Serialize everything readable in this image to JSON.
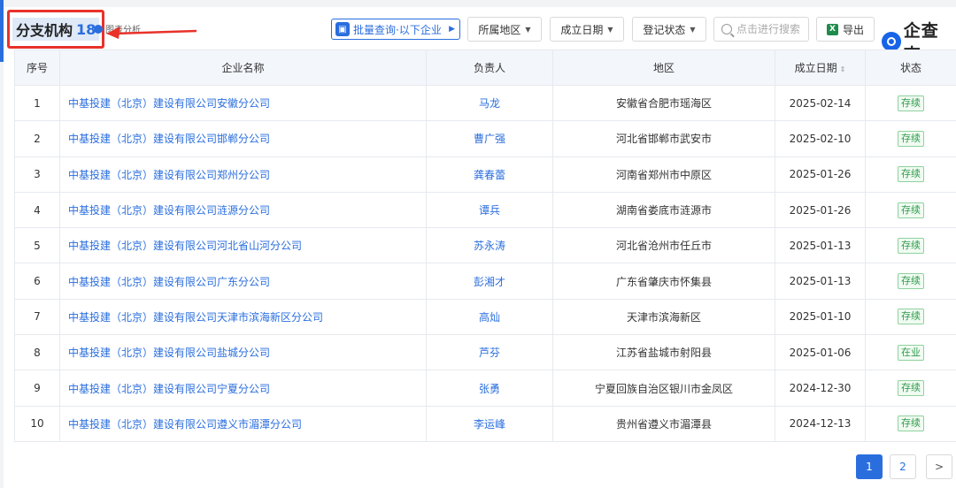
{
  "header": {
    "title": "分支机构",
    "count": "18",
    "chart_link": "图表分析",
    "batch_query": "批量查询·以下企业",
    "filters": [
      "所属地区",
      "成立日期",
      "登记状态"
    ],
    "search_placeholder": "点击进行搜索",
    "export_label": "导出",
    "logo_text": "企查查"
  },
  "table": {
    "columns": [
      "序号",
      "企业名称",
      "负责人",
      "地区",
      "成立日期",
      "状态"
    ],
    "rows": [
      {
        "no": "1",
        "name": "中基投建（北京）建设有限公司安徽分公司",
        "person": "马龙",
        "region": "安徽省合肥市瑶海区",
        "date": "2025-02-14",
        "status": "存续"
      },
      {
        "no": "2",
        "name": "中基投建（北京）建设有限公司邯郸分公司",
        "person": "曹广强",
        "region": "河北省邯郸市武安市",
        "date": "2025-02-10",
        "status": "存续"
      },
      {
        "no": "3",
        "name": "中基投建（北京）建设有限公司郑州分公司",
        "person": "龚春蕾",
        "region": "河南省郑州市中原区",
        "date": "2025-01-26",
        "status": "存续"
      },
      {
        "no": "4",
        "name": "中基投建（北京）建设有限公司涟源分公司",
        "person": "谭兵",
        "region": "湖南省娄底市涟源市",
        "date": "2025-01-26",
        "status": "存续"
      },
      {
        "no": "5",
        "name": "中基投建（北京）建设有限公司河北省山河分公司",
        "person": "苏永涛",
        "region": "河北省沧州市任丘市",
        "date": "2025-01-13",
        "status": "存续"
      },
      {
        "no": "6",
        "name": "中基投建（北京）建设有限公司广东分公司",
        "person": "彭湘才",
        "region": "广东省肇庆市怀集县",
        "date": "2025-01-13",
        "status": "存续"
      },
      {
        "no": "7",
        "name": "中基投建（北京）建设有限公司天津市滨海新区分公司",
        "person": "高灿",
        "region": "天津市滨海新区",
        "date": "2025-01-10",
        "status": "存续"
      },
      {
        "no": "8",
        "name": "中基投建（北京）建设有限公司盐城分公司",
        "person": "芦芬",
        "region": "江苏省盐城市射阳县",
        "date": "2025-01-06",
        "status": "在业"
      },
      {
        "no": "9",
        "name": "中基投建（北京）建设有限公司宁夏分公司",
        "person": "张勇",
        "region": "宁夏回族自治区银川市金凤区",
        "date": "2024-12-30",
        "status": "存续"
      },
      {
        "no": "10",
        "name": "中基投建（北京）建设有限公司遵义市湄潭分公司",
        "person": "李运峰",
        "region": "贵州省遵义市湄潭县",
        "date": "2024-12-13",
        "status": "存续"
      }
    ]
  },
  "pagination": {
    "pages": [
      "1",
      "2"
    ],
    "current": "1",
    "next": ">"
  },
  "colors": {
    "accent": "#2a6ede",
    "highlight_box": "#e8322a",
    "status_green": "#2f9a4a"
  }
}
